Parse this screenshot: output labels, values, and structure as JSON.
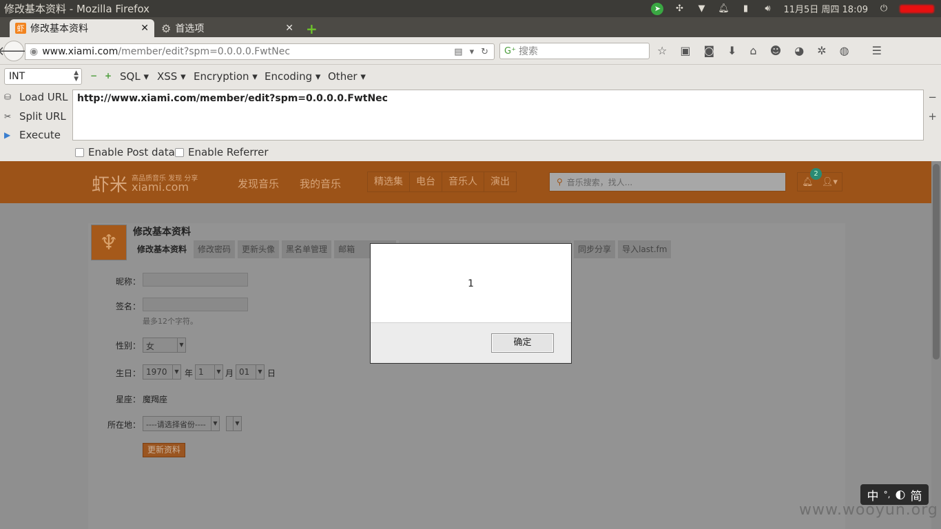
{
  "window": {
    "title": "修改基本资料 - Mozilla Firefox"
  },
  "tray": {
    "datetime": "11月5日 周四 18:09"
  },
  "tabs": [
    {
      "label": "修改基本资料",
      "favicon": "虾"
    },
    {
      "label": "首选项"
    }
  ],
  "nav": {
    "url_host": "www.xiami.com",
    "url_path": "/member/edit?spm=0.0.0.0.FwtNec",
    "search_placeholder": "搜索"
  },
  "hackbar": {
    "type_select": "INT",
    "menus": [
      "SQL",
      "XSS",
      "Encryption",
      "Encoding",
      "Other"
    ],
    "actions": [
      "Load URL",
      "Split URL",
      "Execute"
    ],
    "url_text": "http://www.xiami.com/member/edit?spm=0.0.0.0.FwtNec",
    "enable_post": "Enable Post data",
    "enable_referrer": "Enable Referrer"
  },
  "site": {
    "logo_cn": "虾米",
    "logo_tagline": "高品质音乐 发现 分享",
    "logo_en": "xiami.com",
    "nav": [
      "发现音乐",
      "我的音乐"
    ],
    "tabs": [
      "精选集",
      "电台",
      "音乐人",
      "演出"
    ],
    "search_placeholder": "音乐搜索，找人...",
    "notify_count": "2"
  },
  "profile": {
    "title": "修改基本资料",
    "tabs": [
      "修改基本资料",
      "修改密码",
      "更新头像",
      "黑名单管理",
      "邮箱",
      "同步分享",
      "导入last.fm"
    ],
    "nickname_label": "昵称：",
    "signature_label": "签名：",
    "signature_hint": "最多12个字符。",
    "gender_label": "性别：",
    "gender_value": "女",
    "birthday_label": "生日：",
    "year_value": "1970",
    "year_unit": "年",
    "month_value": "1",
    "month_unit": "月",
    "day_value": "01",
    "day_unit": "日",
    "zodiac_label": "星座：",
    "zodiac_value": "魔羯座",
    "location_label": "所在地：",
    "province_value": "----请选择省份----",
    "submit_label": "更新资料"
  },
  "dialog": {
    "message": "1",
    "ok_label": "确定"
  },
  "ime": {
    "lang": "中",
    "punct": "°,",
    "moon": "◐",
    "mode": "简"
  },
  "watermark": "www.wooyun.org"
}
